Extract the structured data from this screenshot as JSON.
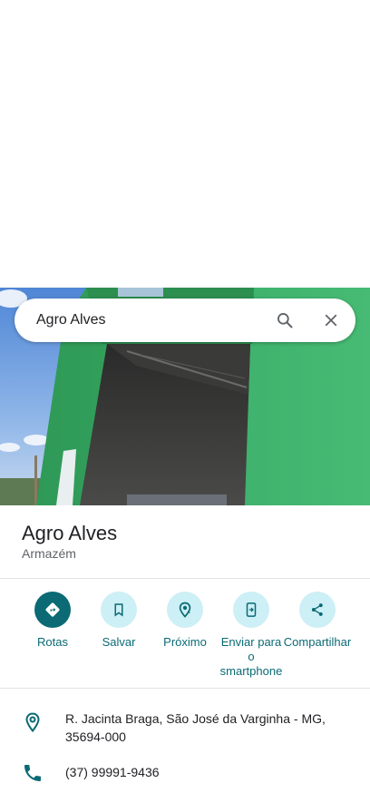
{
  "search": {
    "query": "Agro Alves"
  },
  "place": {
    "name": "Agro Alves",
    "category": "Armazém"
  },
  "actions": [
    {
      "label": "Rotas",
      "icon": "directions-icon"
    },
    {
      "label": "Salvar",
      "icon": "bookmark-icon"
    },
    {
      "label": "Próximo",
      "icon": "nearby-icon"
    },
    {
      "label": "Enviar para o smartphone",
      "icon": "send-to-phone-icon"
    },
    {
      "label": "Compartilhar",
      "icon": "share-icon"
    }
  ],
  "info": {
    "address": "R. Jacinta Braga, São José da Varginha - MG, 35694-000",
    "phone": "(37) 99991-9436"
  },
  "colors": {
    "accent": "#0b6a74",
    "action_bg": "#cdeff6"
  }
}
